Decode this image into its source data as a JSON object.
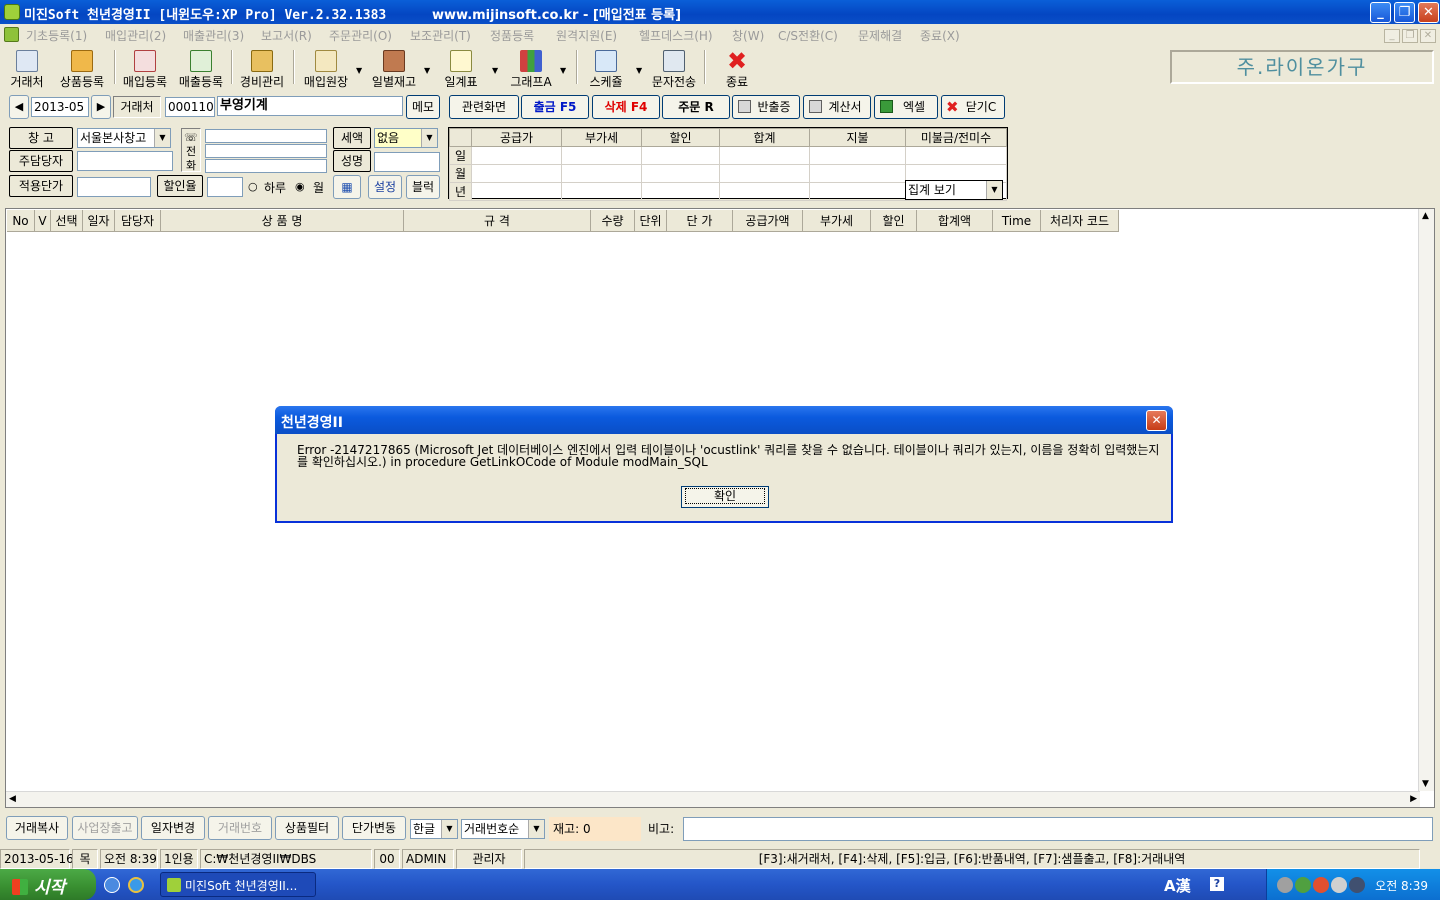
{
  "window": {
    "title": "미진Soft 천년경영II [내윈도우:XP Pro] Ver.2.32.1383",
    "url": "www.mijinsoft.co.kr - [매입전표 등록]",
    "btn_min": "_",
    "btn_max": "❐",
    "btn_close": "✕"
  },
  "menu": [
    "기초등록(1)",
    "매입관리(2)",
    "매출관리(3)",
    "보고서(R)",
    "주문관리(O)",
    "보조관리(T)",
    "정품등록",
    "원격지원(E)",
    "헬프데스크(H)",
    "창(W)",
    "C/S전환(C)",
    "문제해결",
    "종료(X)"
  ],
  "toolbar": [
    "거래처",
    "상품등록",
    "매입등록",
    "매출등록",
    "경비관리",
    "매입원장",
    "일별재고",
    "일계표",
    "그래프A",
    "스케쥴",
    "문자전송",
    "종료"
  ],
  "company_name": "주.라이온가구",
  "form": {
    "prev": "◀",
    "period": "2013-05",
    "next": "▶",
    "client_label": "거래처",
    "client_code": "000110",
    "client_name": "부영기계",
    "memo": "메모",
    "warehouse_label": "창     고",
    "warehouse_value": "서울본사창고",
    "manager_label": "주담당자",
    "price_label": "적용단가",
    "discount_label": "할인율",
    "phone_label": "☏전화",
    "tax_label": "세액",
    "tax_value": "없음",
    "name_label": "성명",
    "day_label": "하루",
    "month_label": "월",
    "setting_btn": "설정",
    "block_btn": "블럭"
  },
  "actions": [
    "관련화면",
    "출금 F5",
    "삭제 F4",
    "주문 R",
    "반출증",
    "계산서",
    "엑셀",
    "닫기C"
  ],
  "summary": {
    "columns": [
      "공급가",
      "부가세",
      "할인",
      "합계",
      "지불",
      "미불금/전미수"
    ],
    "rows": [
      "일",
      "월",
      "년"
    ],
    "combo": "집계 보기"
  },
  "grid": {
    "columns": [
      "No",
      "V",
      "선택",
      "일자",
      "담당자",
      "상 품 명",
      "규 격",
      "수량",
      "단위",
      "단 가",
      "공급가액",
      "부가세",
      "할인",
      "합계액",
      "Time",
      "처리자 코드"
    ]
  },
  "dialog": {
    "title": "천년경영II",
    "message": "Error -2147217865 (Microsoft Jet 데이터베이스 엔진에서 입력 테이블이나 'ocustlink' 쿼리를 찾을 수 없습니다. 테이블이나 쿼리가 있는지, 이름을 정확히 입력했는지를 확인하십시오.) in procedure GetLinkOCode of Module modMain_SQL",
    "ok": "확인"
  },
  "bottom": {
    "copy": "거래복사",
    "ship": "사업장출고",
    "date_change": "일자변경",
    "trade_no": "거래번호",
    "product_filter": "상품필터",
    "price_change": "단가변동",
    "lang": "한글",
    "sort": "거래번호순",
    "stock": "재고: 0",
    "note_label": "비고:"
  },
  "status": {
    "date": "2013-05-16",
    "weekday": "목",
    "time": "오전 8:39",
    "users": "1인용",
    "path": "C:₩천년경영II₩DBS",
    "code": "00",
    "user": "ADMIN",
    "role": "관리자",
    "shortcuts": "[F3]:새거래처, [F4]:삭제, [F5]:입금, [F6]:반품내역, [F7]:샘플출고, [F8]:거래내역"
  },
  "taskbar": {
    "start": "시작",
    "task": "미진Soft 천년경영II...",
    "ime": "A漢",
    "clock": "오전 8:39"
  }
}
